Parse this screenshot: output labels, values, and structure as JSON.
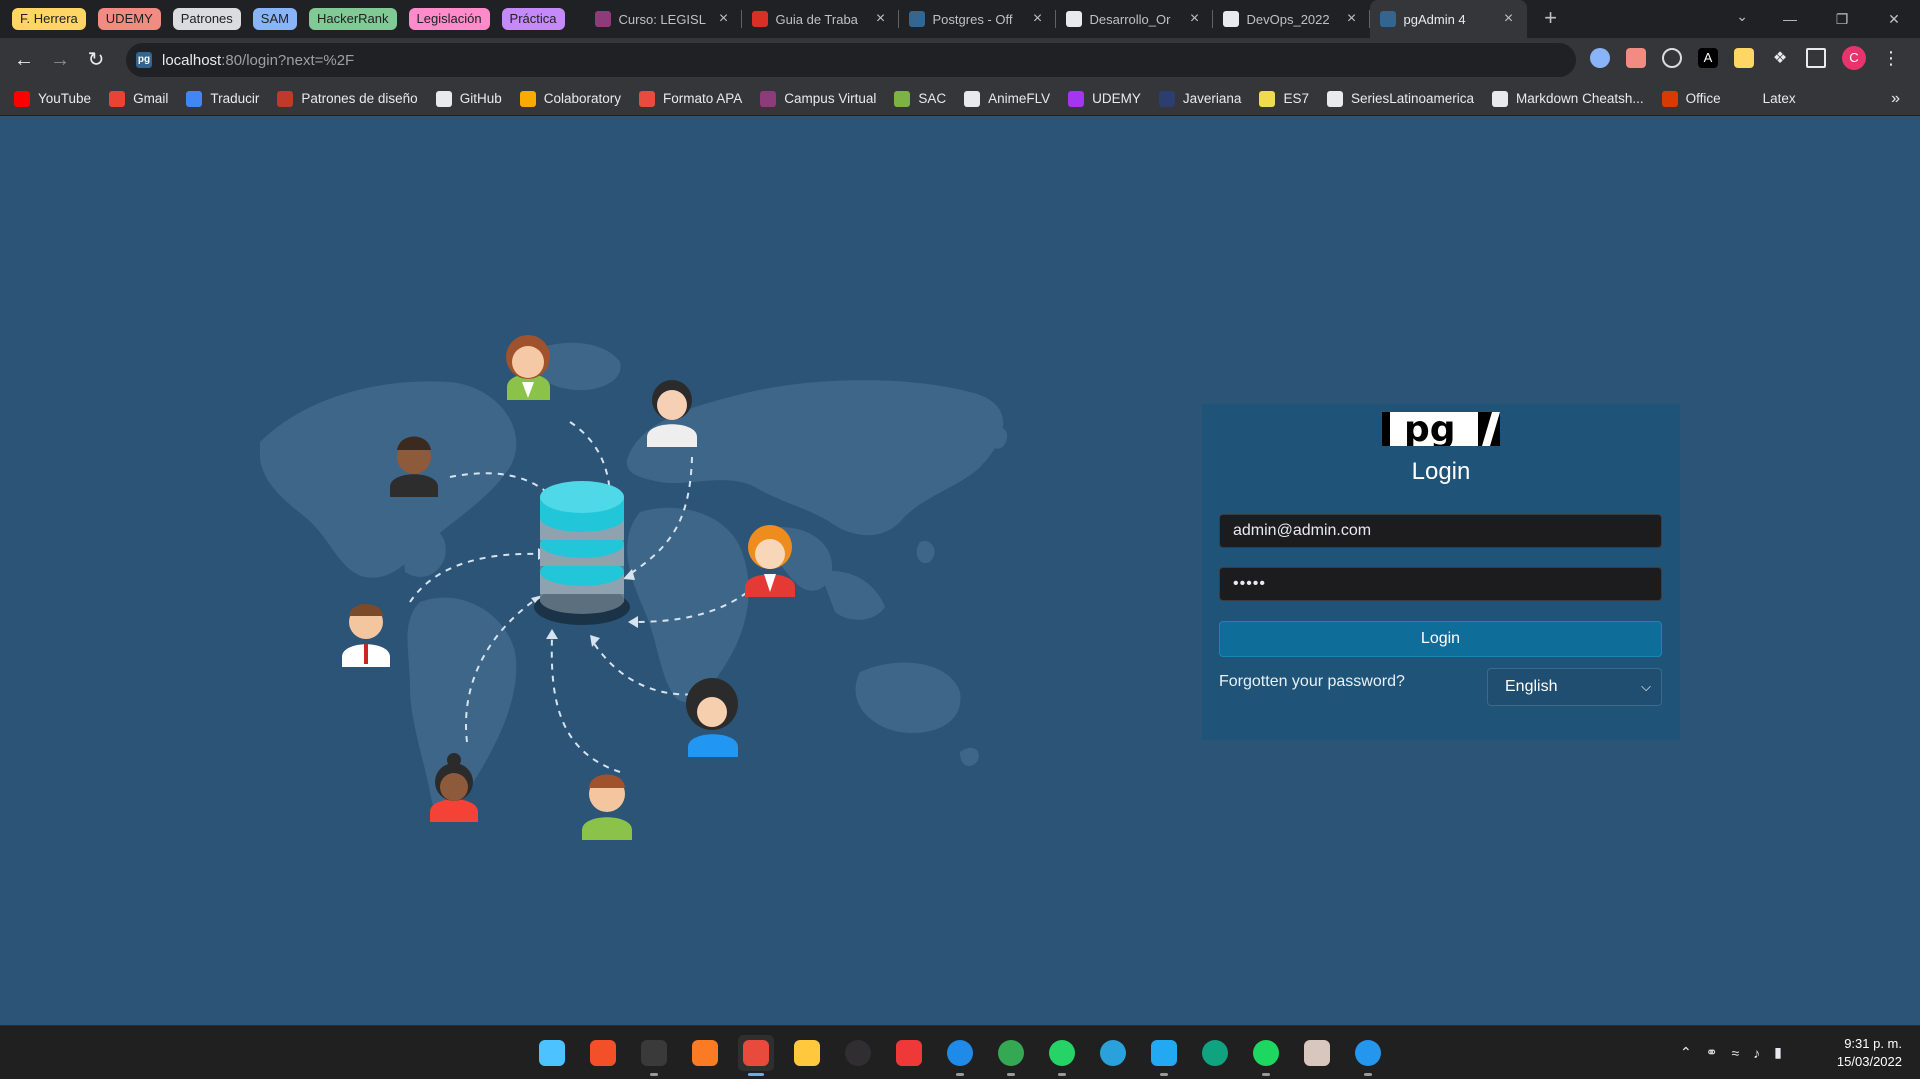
{
  "browser": {
    "tab_groups": [
      {
        "label": "F. Herrera",
        "color": "#fdd663"
      },
      {
        "label": "UDEMY",
        "color": "#f28b82"
      },
      {
        "label": "Patrones",
        "color": "#dadce0"
      },
      {
        "label": "SAM",
        "color": "#8ab4f8"
      },
      {
        "label": "HackerRank",
        "color": "#81c995"
      },
      {
        "label": "Legislación",
        "color": "#ff8bcb"
      },
      {
        "label": "Práctica",
        "color": "#c58af9"
      }
    ],
    "tabs": [
      {
        "title": "Curso: LEGISL",
        "icon": "course-favicon",
        "color": "#8e3b7a"
      },
      {
        "title": "Guia de Traba",
        "icon": "pdf-favicon",
        "color": "#d93025"
      },
      {
        "title": "Postgres - Off",
        "icon": "postgres-favicon",
        "color": "#336791"
      },
      {
        "title": "Desarrollo_Or",
        "icon": "github-favicon",
        "color": "#e8eaed"
      },
      {
        "title": "DevOps_2022",
        "icon": "github-favicon",
        "color": "#e8eaed"
      },
      {
        "title": "pgAdmin 4",
        "icon": "pgadmin-favicon",
        "color": "#326690",
        "active": true
      }
    ],
    "new_tab": "+",
    "url_host": "localhost",
    "url_path": ":80/login?next=%2F",
    "profile_initial": "C",
    "bookmarks": [
      {
        "label": "YouTube",
        "color": "#ff0000"
      },
      {
        "label": "Gmail",
        "color": "#ea4335"
      },
      {
        "label": "Traducir",
        "color": "#4285f4"
      },
      {
        "label": "Patrones de diseño",
        "color": "#c0392b"
      },
      {
        "label": "GitHub",
        "color": "#e8eaed"
      },
      {
        "label": "Colaboratory",
        "color": "#f9ab00"
      },
      {
        "label": "Formato APA",
        "color": "#e74c3c"
      },
      {
        "label": "Campus Virtual",
        "color": "#8e3b7a"
      },
      {
        "label": "SAC",
        "color": "#7cb342"
      },
      {
        "label": "AnimeFLV",
        "color": "#e8eaed"
      },
      {
        "label": "UDEMY",
        "color": "#a435f0"
      },
      {
        "label": "Javeriana",
        "color": "#2c3e70"
      },
      {
        "label": "ES7",
        "color": "#f0db4f"
      },
      {
        "label": "SeriesLatinoamerica",
        "color": "#e8eaed"
      },
      {
        "label": "Markdown Cheatsh...",
        "color": "#e8eaed"
      },
      {
        "label": "Office",
        "color": "#d83b01"
      },
      {
        "label": "Latex",
        "color": "#35363a"
      }
    ],
    "bookmarks_more": "»"
  },
  "login": {
    "logo_text": "pg",
    "title": "Login",
    "email_value": "admin@admin.com",
    "password_mask": "•••••",
    "button_label": "Login",
    "forgot_link": "Forgotten your password?",
    "language": "English"
  },
  "colors": {
    "page_bg": "#2b5477",
    "card_bg": "#1f5378",
    "button_bg": "#0f6d99",
    "database_cyan": "#22c6d9"
  },
  "taskbar": {
    "apps": [
      {
        "name": "windows-start-icon",
        "color": "#4cc2ff"
      },
      {
        "name": "git-icon",
        "color": "#f34f29"
      },
      {
        "name": "terminal-icon",
        "color": "#3a3a3a"
      },
      {
        "name": "xampp-icon",
        "color": "#fb7a24"
      },
      {
        "name": "snipping-tool-icon",
        "color": "#e84b3c",
        "active": true
      },
      {
        "name": "file-explorer-icon",
        "color": "#ffc83d"
      },
      {
        "name": "obs-icon",
        "color": "#302e31"
      },
      {
        "name": "vivaldi-icon",
        "color": "#ef3939"
      },
      {
        "name": "firefox-icon",
        "color": "#1f8ae8"
      },
      {
        "name": "chrome-icon",
        "color": "#34a853"
      },
      {
        "name": "whatsapp-icon",
        "color": "#25d366"
      },
      {
        "name": "telegram-icon",
        "color": "#2aa1da"
      },
      {
        "name": "vscode-icon",
        "color": "#23a9f2"
      },
      {
        "name": "chatgpt-icon",
        "color": "#10a37f"
      },
      {
        "name": "spotify-icon",
        "color": "#1ed760"
      },
      {
        "name": "photo-app-icon",
        "color": "#d8c7bd"
      },
      {
        "name": "docker-icon",
        "color": "#2496ed"
      }
    ],
    "time": "9:31 p. m.",
    "date": "15/03/2022"
  }
}
